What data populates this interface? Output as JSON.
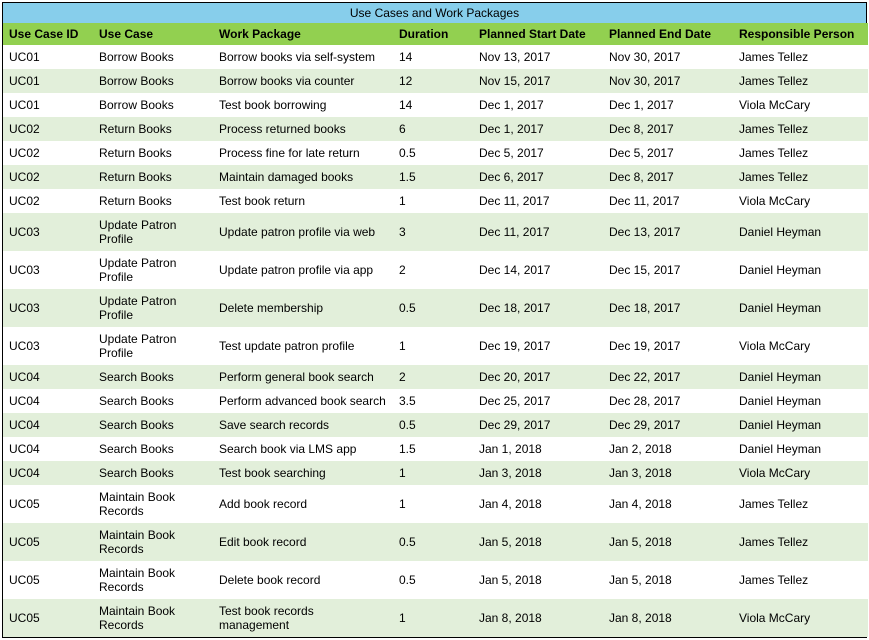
{
  "title": "Use Cases and Work Packages",
  "columns": [
    "Use Case ID",
    "Use Case",
    "Work Package",
    "Duration",
    "Planned Start Date",
    "Planned End Date",
    "Responsible Person"
  ],
  "rows": [
    {
      "id": "UC01",
      "use_case": "Borrow Books",
      "work_package": "Borrow books via self-system",
      "duration": "14",
      "planned_start": "Nov 13, 2017",
      "planned_end": "Nov 30, 2017",
      "responsible": "James Tellez"
    },
    {
      "id": "UC01",
      "use_case": "Borrow Books",
      "work_package": "Borrow books via counter",
      "duration": "12",
      "planned_start": "Nov 15, 2017",
      "planned_end": "Nov 30, 2017",
      "responsible": "James Tellez"
    },
    {
      "id": "UC01",
      "use_case": "Borrow Books",
      "work_package": "Test book borrowing",
      "duration": "14",
      "planned_start": "Dec 1, 2017",
      "planned_end": "Dec 1, 2017",
      "responsible": "Viola McCary"
    },
    {
      "id": "UC02",
      "use_case": "Return Books",
      "work_package": "Process returned books",
      "duration": "6",
      "planned_start": "Dec 1, 2017",
      "planned_end": "Dec 8, 2017",
      "responsible": "James Tellez"
    },
    {
      "id": "UC02",
      "use_case": "Return Books",
      "work_package": "Process fine for late return",
      "duration": "0.5",
      "planned_start": "Dec 5, 2017",
      "planned_end": "Dec 5, 2017",
      "responsible": "James Tellez"
    },
    {
      "id": "UC02",
      "use_case": "Return Books",
      "work_package": "Maintain damaged books",
      "duration": "1.5",
      "planned_start": "Dec 6, 2017",
      "planned_end": "Dec 8, 2017",
      "responsible": "James Tellez"
    },
    {
      "id": "UC02",
      "use_case": "Return Books",
      "work_package": "Test book return",
      "duration": "1",
      "planned_start": "Dec 11, 2017",
      "planned_end": "Dec 11, 2017",
      "responsible": "Viola McCary"
    },
    {
      "id": "UC03",
      "use_case": "Update Patron Profile",
      "work_package": "Update patron profile via web",
      "duration": "3",
      "planned_start": "Dec 11, 2017",
      "planned_end": "Dec 13, 2017",
      "responsible": "Daniel Heyman"
    },
    {
      "id": "UC03",
      "use_case": "Update Patron Profile",
      "work_package": "Update patron profile via app",
      "duration": "2",
      "planned_start": "Dec 14, 2017",
      "planned_end": "Dec 15, 2017",
      "responsible": "Daniel Heyman"
    },
    {
      "id": "UC03",
      "use_case": "Update Patron Profile",
      "work_package": "Delete membership",
      "duration": "0.5",
      "planned_start": "Dec 18, 2017",
      "planned_end": "Dec 18, 2017",
      "responsible": "Daniel Heyman"
    },
    {
      "id": "UC03",
      "use_case": "Update Patron Profile",
      "work_package": "Test update patron profile",
      "duration": "1",
      "planned_start": "Dec 19, 2017",
      "planned_end": "Dec 19, 2017",
      "responsible": "Viola McCary"
    },
    {
      "id": "UC04",
      "use_case": "Search Books",
      "work_package": "Perform general book search",
      "duration": "2",
      "planned_start": "Dec 20, 2017",
      "planned_end": "Dec 22, 2017",
      "responsible": "Daniel Heyman"
    },
    {
      "id": "UC04",
      "use_case": "Search Books",
      "work_package": "Perform advanced book search",
      "duration": "3.5",
      "planned_start": "Dec 25, 2017",
      "planned_end": "Dec 28, 2017",
      "responsible": "Daniel Heyman"
    },
    {
      "id": "UC04",
      "use_case": "Search Books",
      "work_package": "Save search records",
      "duration": "0.5",
      "planned_start": "Dec 29, 2017",
      "planned_end": "Dec 29, 2017",
      "responsible": "Daniel Heyman"
    },
    {
      "id": "UC04",
      "use_case": "Search Books",
      "work_package": "Search book via LMS app",
      "duration": "1.5",
      "planned_start": "Jan 1, 2018",
      "planned_end": "Jan 2, 2018",
      "responsible": "Daniel Heyman"
    },
    {
      "id": "UC04",
      "use_case": "Search Books",
      "work_package": "Test book searching",
      "duration": "1",
      "planned_start": "Jan 3, 2018",
      "planned_end": "Jan 3, 2018",
      "responsible": "Viola McCary"
    },
    {
      "id": "UC05",
      "use_case": "Maintain Book Records",
      "work_package": "Add book record",
      "duration": "1",
      "planned_start": "Jan 4, 2018",
      "planned_end": "Jan 4, 2018",
      "responsible": "James Tellez"
    },
    {
      "id": "UC05",
      "use_case": "Maintain Book Records",
      "work_package": "Edit book record",
      "duration": "0.5",
      "planned_start": "Jan 5, 2018",
      "planned_end": "Jan 5, 2018",
      "responsible": "James Tellez"
    },
    {
      "id": "UC05",
      "use_case": "Maintain Book Records",
      "work_package": "Delete book record",
      "duration": "0.5",
      "planned_start": "Jan 5, 2018",
      "planned_end": "Jan 5, 2018",
      "responsible": "James Tellez"
    },
    {
      "id": "UC05",
      "use_case": "Maintain Book Records",
      "work_package": "Test book records management",
      "duration": "1",
      "planned_start": "Jan 8, 2018",
      "planned_end": "Jan 8, 2018",
      "responsible": "Viola McCary"
    }
  ]
}
